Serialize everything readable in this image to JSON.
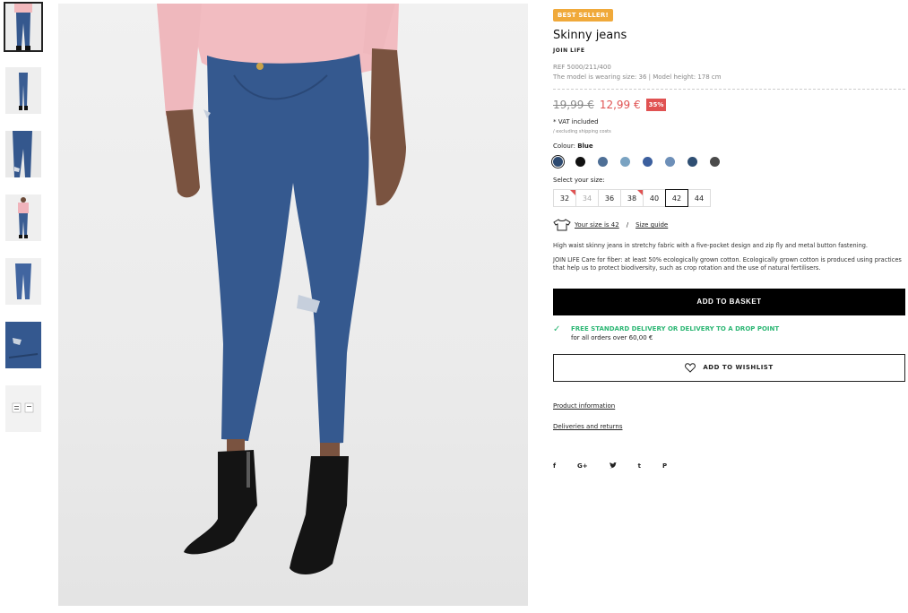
{
  "product": {
    "badge": "BEST SELLER!",
    "title": "Skinny jeans",
    "collection": "JOIN LIFE",
    "ref": "REF 5000/211/400",
    "model_info": "The model is wearing size: 36 | Model height: 178 cm"
  },
  "pricing": {
    "old_price": "19,99 €",
    "new_price": "12,99 €",
    "discount": "35%",
    "vat": "* VAT included",
    "shipping_note": "/ excluding shipping costs"
  },
  "colour": {
    "label": "Colour:",
    "selected": "Blue",
    "swatches": [
      "#2d4a70",
      "#111111",
      "#4e6f96",
      "#7aa3c2",
      "#3c5f9e",
      "#6d8fb8",
      "#2f4f73",
      "#4a4a4a"
    ]
  },
  "size": {
    "label": "Select your size:",
    "options": [
      {
        "label": "32",
        "state": "low"
      },
      {
        "label": "34",
        "state": "disabled"
      },
      {
        "label": "36",
        "state": "normal"
      },
      {
        "label": "38",
        "state": "low"
      },
      {
        "label": "40",
        "state": "normal"
      },
      {
        "label": "42",
        "state": "selected"
      },
      {
        "label": "44",
        "state": "normal"
      }
    ],
    "your_size": "Your size is 42",
    "separator": "/",
    "guide": "Size guide"
  },
  "description": {
    "p1": "High waist skinny jeans in stretchy fabric with a five-pocket design and zip fly and metal button fastening.",
    "p2": "JOIN LIFE Care for fiber: at least 50% ecologically grown cotton. Ecologically grown cotton is produced using practices that help us to protect biodiversity, such as crop rotation and the use of natural fertilisers."
  },
  "actions": {
    "basket": "ADD TO BASKET",
    "wishlist": "ADD TO WISHLIST"
  },
  "delivery": {
    "check": "✓",
    "title": "FREE STANDARD DELIVERY OR DELIVERY TO A DROP POINT",
    "sub": "for all orders over 60,00 €"
  },
  "links": {
    "product_info": "Product information",
    "deliveries": "Deliveries and returns"
  },
  "social": [
    "f",
    "G+",
    "t-bird",
    "t",
    "P"
  ]
}
